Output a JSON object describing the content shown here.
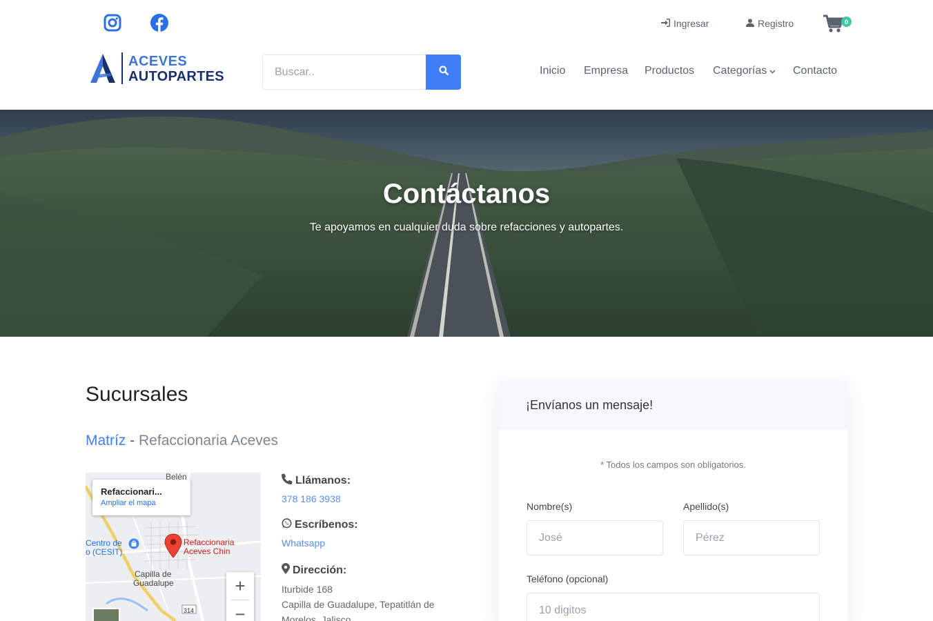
{
  "topbar": {
    "login_label": "Ingresar",
    "register_label": "Registro",
    "cart_count": "0"
  },
  "logo": {
    "line1": "ACEVES",
    "line2": "AUTOPARTES"
  },
  "search": {
    "placeholder": "Buscar.."
  },
  "nav": {
    "inicio": "Inicio",
    "empresa": "Empresa",
    "productos": "Productos",
    "categorias": "Categorías",
    "contacto": "Contacto"
  },
  "hero": {
    "title": "Contáctanos",
    "subtitle": "Te apoyamos en cualquier duda sobre refacciones y autopartes."
  },
  "branches": {
    "title": "Sucursales",
    "branch_label": "Matríz",
    "branch_dash": " - ",
    "branch_name": "Refaccionaria Aceves",
    "map": {
      "card_title": "Refaccionari...",
      "card_link": "Ampliar el mapa",
      "label_belen": "Belén",
      "label_centro_1": "Centro de",
      "label_centro_2": "o (CESIT)",
      "label_pin_1": "Refaccionaria",
      "label_pin_2": "Aceves Chin",
      "label_capilla_1": "Capilla de",
      "label_capilla_2": "Guadalupe",
      "road_number": "314",
      "zoom_in": "+",
      "zoom_out": "−"
    },
    "call_head": "Llámanos:",
    "call_value": "378 186 3938",
    "write_head": "Escríbenos:",
    "write_value": "Whatsapp",
    "address_head": "Dirección:",
    "address_line1": "Iturbide 168",
    "address_line2": "Capilla de Guadalupe, Tepatitlán de Morelos, Jalisco."
  },
  "form": {
    "title": "¡Envíanos un mensaje!",
    "note": "* Todos los campos son obligatorios.",
    "first_name_label": "Nombre(s)",
    "first_name_placeholder": "José",
    "last_name_label": "Apellido(s)",
    "last_name_placeholder": "Pérez",
    "phone_label": "Teléfono (opcional)",
    "phone_placeholder": "10 digitos"
  },
  "colors": {
    "accent": "#3f7ef7",
    "brand_dark": "#1a2f6e",
    "badge": "#3cc9a3"
  }
}
